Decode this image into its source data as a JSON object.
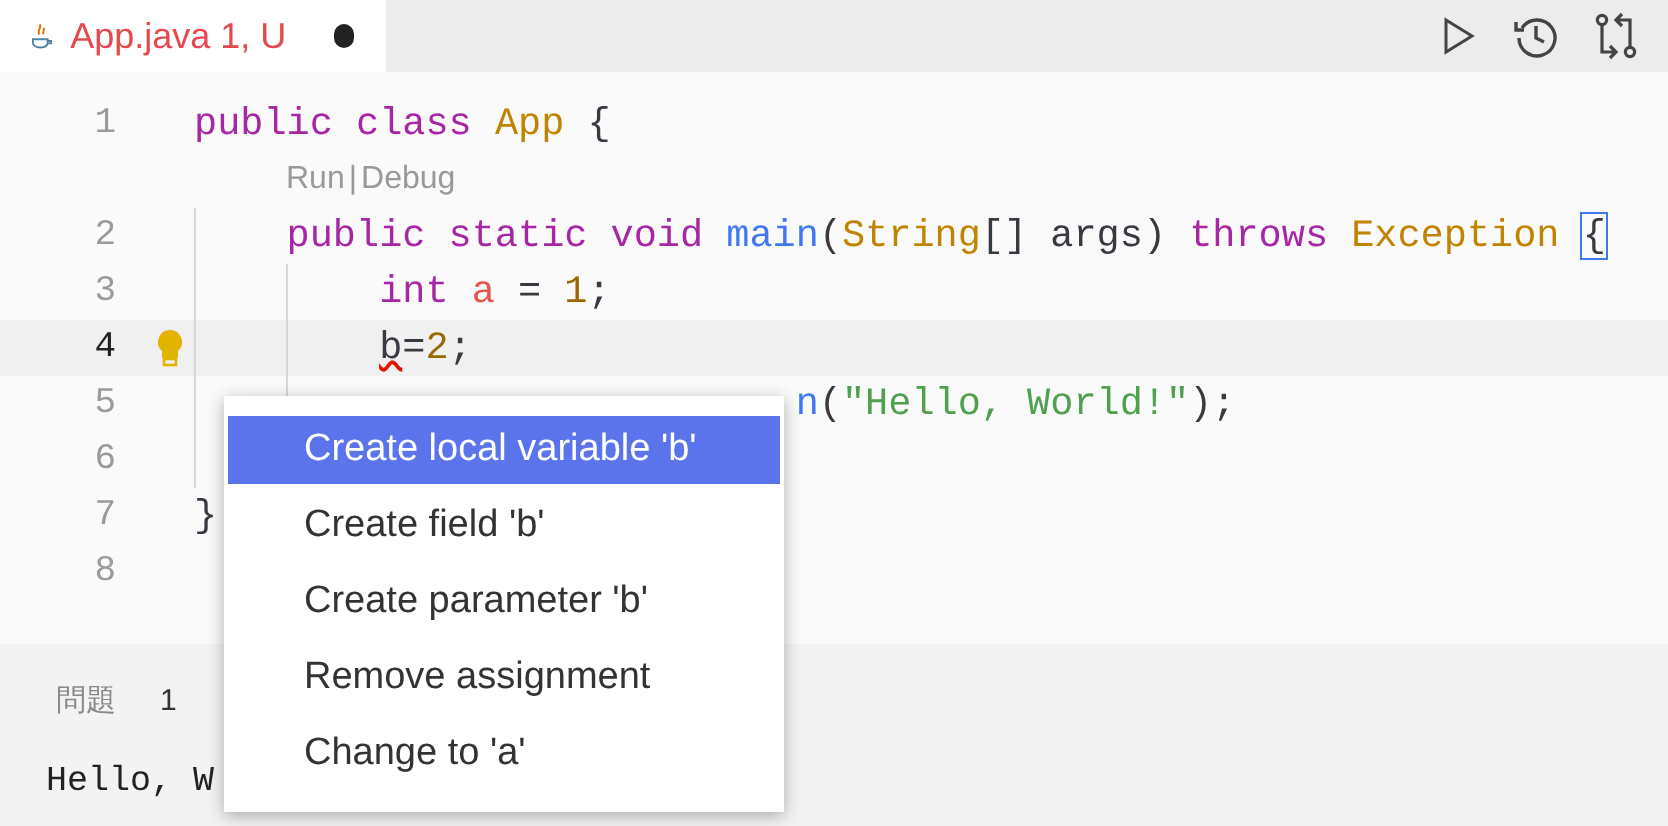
{
  "tab": {
    "title": "App.java 1, U",
    "modified": true,
    "selected": true
  },
  "codelens": {
    "run": "Run",
    "separator": "|",
    "debug": "Debug"
  },
  "lines": [
    {
      "number": "1",
      "current": false,
      "tokens": [
        {
          "text": "public ",
          "kind": "keyword"
        },
        {
          "text": "class ",
          "kind": "keyword"
        },
        {
          "text": "App ",
          "kind": "type"
        },
        {
          "text": "{",
          "kind": "plain"
        }
      ]
    },
    {
      "number": "2",
      "current": false,
      "tokens": [
        {
          "text": "public ",
          "kind": "keyword"
        },
        {
          "text": "static ",
          "kind": "keyword"
        },
        {
          "text": "void ",
          "kind": "keyword"
        },
        {
          "text": "main",
          "kind": "function"
        },
        {
          "text": "(",
          "kind": "plain"
        },
        {
          "text": "String",
          "kind": "type"
        },
        {
          "text": "[] args) ",
          "kind": "plain"
        },
        {
          "text": "throws ",
          "kind": "keyword"
        },
        {
          "text": "Exception ",
          "kind": "type"
        },
        {
          "text": "{",
          "kind": "bracket_match"
        }
      ]
    },
    {
      "number": "3",
      "current": false,
      "tokens": [
        {
          "text": "int ",
          "kind": "keyword"
        },
        {
          "text": "a",
          "kind": "variable"
        },
        {
          "text": " = ",
          "kind": "plain"
        },
        {
          "text": "1",
          "kind": "number"
        },
        {
          "text": ";",
          "kind": "plain"
        }
      ]
    },
    {
      "number": "4",
      "current": true,
      "lightbulb": true,
      "tokens": [
        {
          "text": "b",
          "kind": "error"
        },
        {
          "text": "=",
          "kind": "plain"
        },
        {
          "text": "2",
          "kind": "number"
        },
        {
          "text": ";",
          "kind": "plain"
        }
      ]
    },
    {
      "number": "5",
      "current": false,
      "tokens": [
        {
          "text": "n",
          "kind": "function"
        },
        {
          "text": "(",
          "kind": "plain"
        },
        {
          "text": "\"Hello, World!\"",
          "kind": "string"
        },
        {
          "text": ");",
          "kind": "plain"
        }
      ]
    },
    {
      "number": "6",
      "current": false
    },
    {
      "number": "7",
      "current": false,
      "tokens": [
        {
          "text": "}",
          "kind": "plain"
        }
      ]
    },
    {
      "number": "8",
      "current": false
    }
  ],
  "panel": {
    "tab_label": "問題",
    "badge": "1",
    "terminal_output": "Hello, W"
  },
  "quick_fix_menu": [
    {
      "label": "Create local variable 'b'",
      "selected": true
    },
    {
      "label": "Create field 'b'",
      "selected": false
    },
    {
      "label": "Create parameter 'b'",
      "selected": false
    },
    {
      "label": "Remove assignment",
      "selected": false
    },
    {
      "label": "Change to 'a'",
      "selected": false
    }
  ]
}
